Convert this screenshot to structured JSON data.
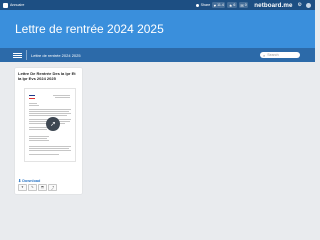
{
  "topbar": {
    "menu_label": "Annuaire",
    "share_label": "Share",
    "counters": [
      {
        "icon": "heart-icon",
        "value": "11.4"
      },
      {
        "icon": "star-icon",
        "value": "6"
      },
      {
        "icon": "comment-icon",
        "value": "0"
      }
    ],
    "brand": "netboard.me"
  },
  "hero": {
    "title": "Lettre de rentrée 2024 2025"
  },
  "subbar": {
    "breadcrumb": "Lettre de rentrée 2024 2025",
    "search_placeholder": "Search"
  },
  "card": {
    "title": "Lettre De Rentrée Des Ia Ipr Et Ia Ipr Evs 2024 2025",
    "download_label": "Download"
  },
  "colors": {
    "topbar": "#1d4f83",
    "hero": "#3a8fdc",
    "subbar": "#2c6aa9",
    "accent": "#2a76c6"
  }
}
